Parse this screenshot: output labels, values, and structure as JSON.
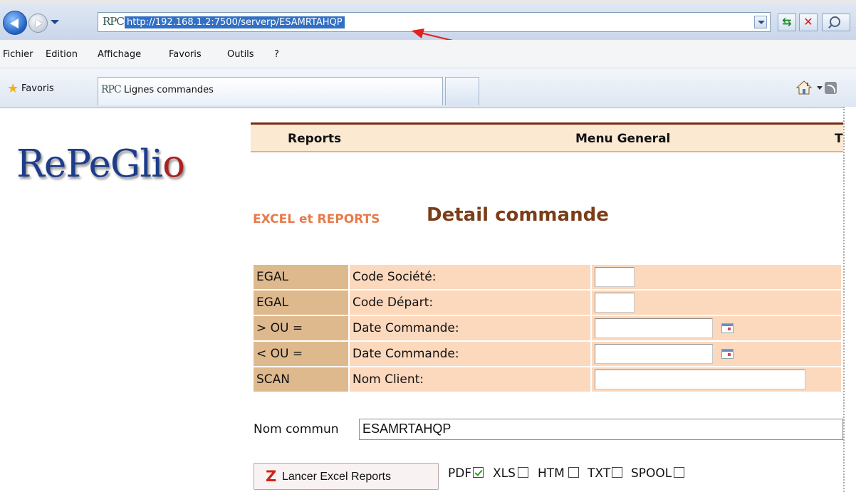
{
  "browser": {
    "url": "http://192.168.1.2:7500/serverp/ESAMRTAHQP",
    "favicon_text": "RPC",
    "menu": [
      "Fichier",
      "Edition",
      "Affichage",
      "Favoris",
      "Outils",
      "?"
    ],
    "favorites_label": "Favoris",
    "tab_label": "Lignes commandes",
    "tab_favicon_text": "RPC"
  },
  "page": {
    "logo_text": "RePeGli",
    "logo_last_letter": "o",
    "nav": [
      "Reports",
      "Menu General",
      "T"
    ],
    "section_subtitle": "EXCEL et REPORTS",
    "section_title": "Detail commande",
    "criteria": [
      {
        "operator": "EGAL",
        "label": "Code Société:"
      },
      {
        "operator": "EGAL",
        "label": "Code Départ:"
      },
      {
        "operator": "> OU =",
        "label": "Date Commande:"
      },
      {
        "operator": "< OU =",
        "label": "Date Commande:"
      },
      {
        "operator": "SCAN",
        "label": "Nom Client:"
      }
    ],
    "common_name_label": "Nom commun",
    "common_name_value": "ESAMRTAHQP",
    "run_button_icon": "Z",
    "run_button_label": "Lancer Excel Reports",
    "formats": [
      {
        "label": "PDF",
        "checked": true
      },
      {
        "label": "XLS",
        "checked": false
      },
      {
        "label": "HTM",
        "checked": false
      },
      {
        "label": "TXT",
        "checked": false
      },
      {
        "label": "SPOOL",
        "checked": false
      }
    ]
  },
  "colors": {
    "annotation_arrow": "#e02020",
    "nav_bar_bg": "#fce9d2",
    "operator_cell_bg": "#dfb98e",
    "label_cell_bg": "#fcd8bd",
    "title_color": "#7a3e18",
    "subtitle_color": "#e87a4a"
  }
}
